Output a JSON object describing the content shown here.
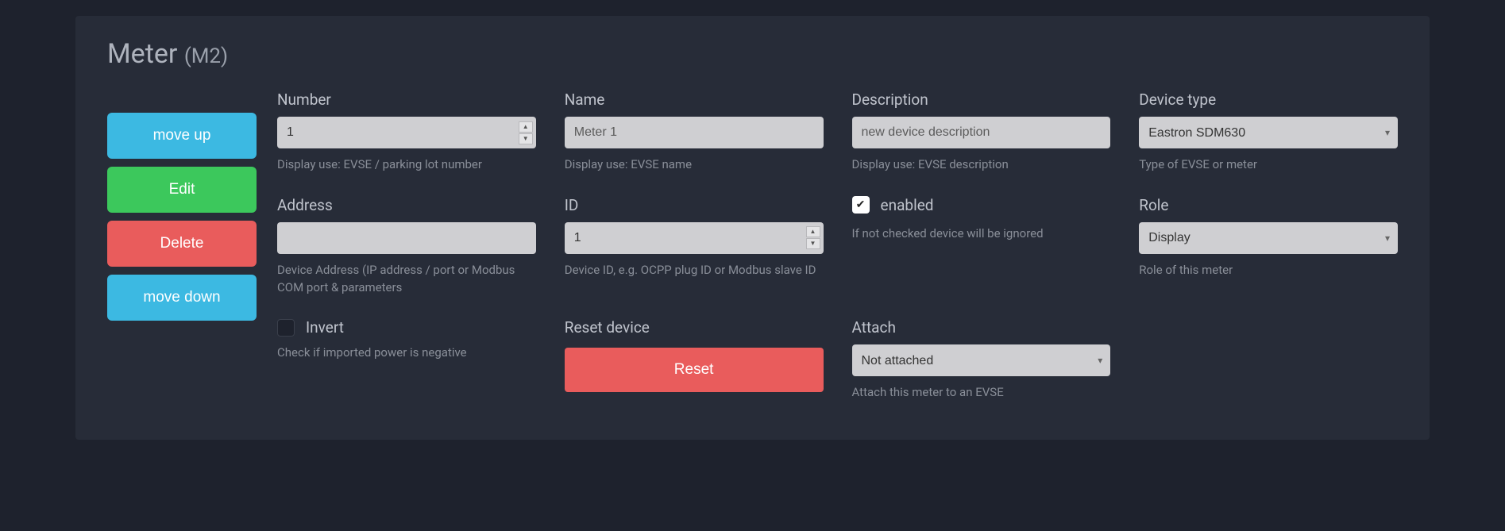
{
  "title": {
    "main": "Meter",
    "sub": "(M2)"
  },
  "actions": {
    "move_up": "move up",
    "edit": "Edit",
    "delete": "Delete",
    "move_down": "move down"
  },
  "fields": {
    "number": {
      "label": "Number",
      "value": "1",
      "help": "Display use: EVSE / parking lot number"
    },
    "name": {
      "label": "Name",
      "value": "Meter 1",
      "help": "Display use: EVSE name"
    },
    "description": {
      "label": "Description",
      "value": "new device description",
      "help": "Display use: EVSE description"
    },
    "device_type": {
      "label": "Device type",
      "value": "Eastron SDM630",
      "help": "Type of EVSE or meter"
    },
    "address": {
      "label": "Address",
      "value": "",
      "help": "Device Address (IP address / port or Modbus COM port & parameters"
    },
    "id": {
      "label": "ID",
      "value": "1",
      "help": "Device ID, e.g. OCPP plug ID or Modbus slave ID"
    },
    "enabled": {
      "label": "enabled",
      "checked": true,
      "help": "If not checked device will be ignored"
    },
    "role": {
      "label": "Role",
      "value": "Display",
      "help": "Role of this meter"
    },
    "invert": {
      "label": "Invert",
      "checked": false,
      "help": "Check if imported power is negative"
    },
    "reset": {
      "label": "Reset device",
      "button": "Reset"
    },
    "attach": {
      "label": "Attach",
      "value": "Not attached",
      "help": "Attach this meter to an EVSE"
    }
  }
}
